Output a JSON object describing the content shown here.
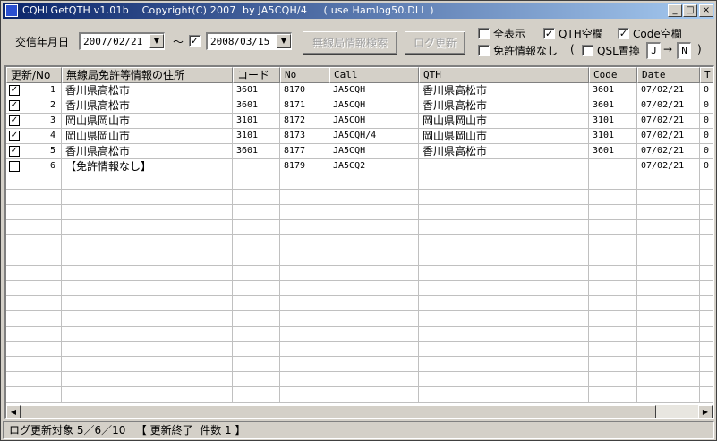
{
  "window": {
    "title": "CQHLGetQTH v1.01b    Copyright(C) 2007  by JA5CQH/4     ( use Hamlog50.DLL )",
    "min_label": "_",
    "max_label": "□",
    "close_label": "×"
  },
  "filters": {
    "date_label": "交信年月日",
    "date_from": "2007/02/21",
    "tilde": "～",
    "date_to_enabled": "✓",
    "date_to": "2008/03/15",
    "search_button": "無線局情報検索",
    "log_update_button": "ログ更新",
    "show_all": {
      "label": "全表示",
      "checked": ""
    },
    "qth_blank": {
      "label": "QTH空欄",
      "checked": "✓"
    },
    "code_blank": {
      "label": "Code空欄",
      "checked": "✓"
    },
    "no_license": {
      "label": "免許情報なし",
      "checked": ""
    },
    "paren_open": "(",
    "qsl_replace": {
      "label": "QSL置換",
      "checked": "",
      "from": "J",
      "arrow": "→",
      "to": "N"
    },
    "paren_close": ")"
  },
  "table": {
    "columns": [
      "更新/No",
      "無線局免許等情報の住所",
      "コード",
      "No",
      "Call",
      "QTH",
      "Code",
      "Date",
      "T"
    ],
    "rows": [
      {
        "checked": "✓",
        "no": "1",
        "address": "香川県高松市",
        "code": "3601",
        "num": "8170",
        "call": "JA5CQH",
        "qth": "香川県高松市",
        "code2": "3601",
        "date": "07/02/21",
        "t": "0"
      },
      {
        "checked": "✓",
        "no": "2",
        "address": "香川県高松市",
        "code": "3601",
        "num": "8171",
        "call": "JA5CQH",
        "qth": "香川県高松市",
        "code2": "3601",
        "date": "07/02/21",
        "t": "0"
      },
      {
        "checked": "✓",
        "no": "3",
        "address": "岡山県岡山市",
        "code": "3101",
        "num": "8172",
        "call": "JA5CQH",
        "qth": "岡山県岡山市",
        "code2": "3101",
        "date": "07/02/21",
        "t": "0"
      },
      {
        "checked": "✓",
        "no": "4",
        "address": "岡山県岡山市",
        "code": "3101",
        "num": "8173",
        "call": "JA5CQH/4",
        "qth": "岡山県岡山市",
        "code2": "3101",
        "date": "07/02/21",
        "t": "0"
      },
      {
        "checked": "✓",
        "no": "5",
        "address": "香川県高松市",
        "code": "3601",
        "num": "8177",
        "call": "JA5CQH",
        "qth": "香川県高松市",
        "code2": "3601",
        "date": "07/02/21",
        "t": "0"
      },
      {
        "checked": "",
        "no": "6",
        "address": "【免許情報なし】",
        "code": "",
        "num": "8179",
        "call": "JA5CQ2",
        "qth": "",
        "code2": "",
        "date": "07/02/21",
        "t": "0"
      }
    ]
  },
  "scroll": {
    "left": "◀",
    "right": "▶"
  },
  "status": "ログ更新対象 5／6／10   【 更新終了  件数 1 】"
}
